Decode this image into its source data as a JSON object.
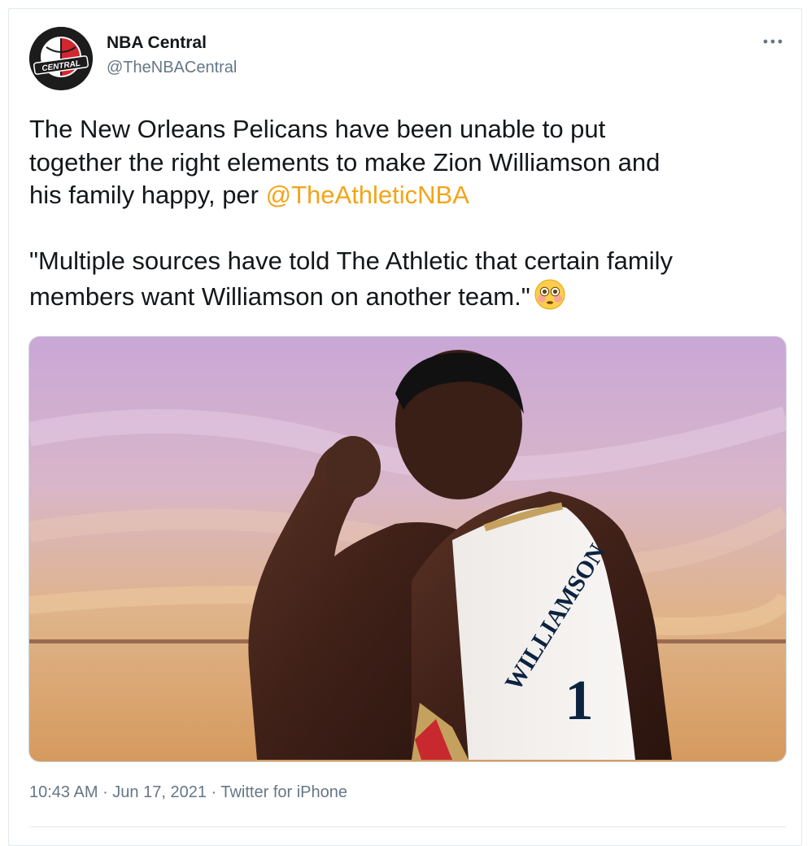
{
  "tweet": {
    "author": {
      "name": "NBA Central",
      "handle": "@TheNBACentral",
      "avatar_icon": "nba-central-logo",
      "avatar_text": "CENTRAL"
    },
    "more_icon": "more-options-icon",
    "text_line1_prefix": "The New Orleans Pelicans have been unable to put\ntogether the right elements to make Zion Williamson and\nhis family happy, per ",
    "mention": "@TheAthleticNBA",
    "quote": "\"Multiple sources have told The Athletic that certain family\nmembers want Williamson on another team.\"",
    "emoji": "flushed-face-emoji",
    "media": {
      "jersey_name": "WILLIAMSON",
      "jersey_number": "1"
    },
    "time": "10:43 AM",
    "date": "Jun 17, 2021",
    "separator": " · ",
    "source": "Twitter for iPhone"
  },
  "colors": {
    "mention": "#f4a418",
    "secondary_text": "#657786",
    "primary_text": "#14171a",
    "border": "#e1e8ed"
  }
}
